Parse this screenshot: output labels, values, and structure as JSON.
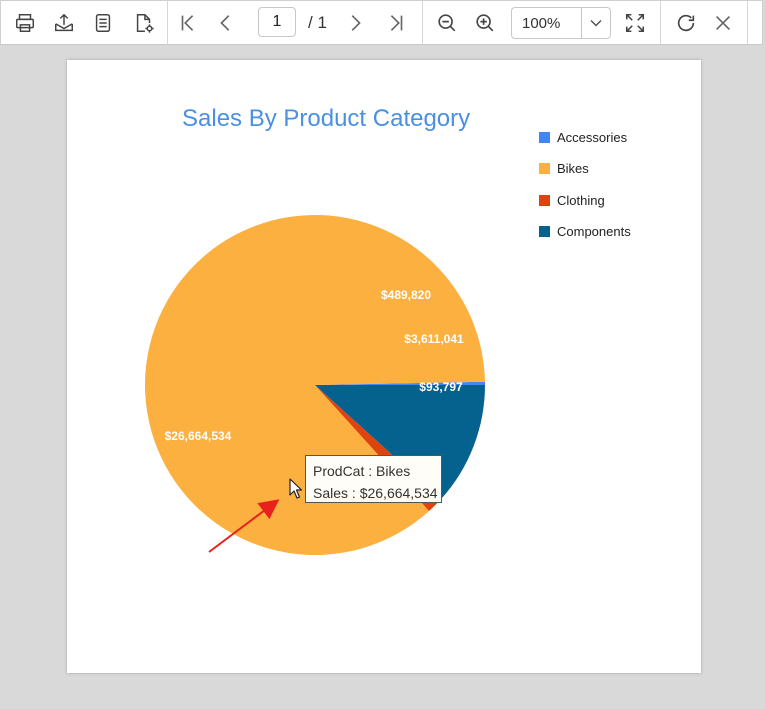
{
  "toolbar": {
    "page_current": "1",
    "page_total": "/ 1",
    "zoom": "100%"
  },
  "colors": {
    "accent_title": "#4a90e2",
    "accessories": "#4285f4",
    "bikes": "#fbb040",
    "clothing": "#e0440e",
    "components": "#05628f"
  },
  "icons": [
    "print-icon",
    "export-icon",
    "document-map-icon",
    "page-setup-icon",
    "first-page-icon",
    "previous-page-icon",
    "next-page-icon",
    "last-page-icon",
    "zoom-out-icon",
    "zoom-in-icon",
    "fit-page-icon",
    "refresh-icon",
    "close-icon",
    "chevron-down-icon",
    "mouse-cursor-icon"
  ],
  "chart_data": {
    "type": "pie",
    "title": "Sales By Product Category",
    "legend_position": "top-right",
    "categories": [
      "Accessories",
      "Bikes",
      "Clothing",
      "Components"
    ],
    "values": [
      93797,
      26664534,
      489820,
      3611041
    ],
    "data_labels": [
      "$93,797",
      "$26,664,534",
      "$489,820",
      "$3,611,041"
    ]
  },
  "tooltip": {
    "line1": "ProdCat : Bikes",
    "line2": "Sales : $26,664,534"
  }
}
